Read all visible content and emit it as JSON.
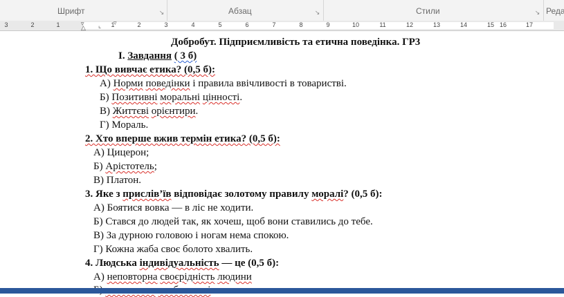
{
  "ribbon": {
    "groups": [
      {
        "label": "Шрифт"
      },
      {
        "label": "Абзац"
      },
      {
        "label": "Стили"
      },
      {
        "label": "Реда"
      }
    ]
  },
  "ruler": {
    "numbers": [
      "3",
      "2",
      "1",
      "1",
      "2",
      "3",
      "4",
      "5",
      "6",
      "7",
      "8",
      "9",
      "10",
      "11",
      "12",
      "13",
      "14",
      "15",
      "16",
      "17"
    ]
  },
  "document": {
    "title": "Добробут. Підприємливість та етична поведінка. ГР3",
    "section": {
      "roman": "I.",
      "label": "Завдання",
      "points": "( 3 б)"
    },
    "q1": {
      "question": "1. Що вивчає етика? (0,5 б):",
      "a": {
        "prefix": "А) ",
        "w1": "Норми",
        "s1": " ",
        "w2": "поведінки",
        "rest": " і правила ввічливості в товаристві."
      },
      "b": {
        "prefix": "Б) ",
        "w1": "Позитивні",
        "s1": " ",
        "w2": "моральні",
        "s2": " ",
        "w3": "цінності",
        "rest": "."
      },
      "c": {
        "prefix": "В) ",
        "w1": "Життєві",
        "s1": " ",
        "w2": "орієнтири",
        "rest": "."
      },
      "d": "Г) Мораль."
    },
    "q2": {
      "question": "2. Хто вперше вжив термін етика? (0,5 б):",
      "a": "А) Цицерон;",
      "b": {
        "prefix": "Б) ",
        "w1": "Арістотель",
        "rest": ";"
      },
      "c": "В) Платон."
    },
    "q3": {
      "question_start": "3. Яке з ",
      "question_w": "прислів’їв",
      "question_mid": " відповідає золотому правилу ",
      "question_w2": "моралі",
      "question_end": "? (0,5 б):",
      "a": "А) Боятися вовка — в ліс не ходити.",
      "b": "Б) Стався до людей так, як хочеш, щоб вони ставились до тебе.",
      "c": "В) За дурною головою і ногам нема спокою.",
      "d": "Г) Кожна жаба своє болото хвалить."
    },
    "q4": {
      "question_start": "4. Людська ",
      "question_w": "індивідуальність",
      "question_end": " — це (0,5 б):",
      "a": {
        "prefix": "А) ",
        "w1": "неповторна",
        "s1": " ",
        "w2": "своєрідність",
        "s2": " ",
        "w3": "людини"
      },
      "b": {
        "prefix": "Б) ",
        "w1": "самоповага",
        "s1": " ",
        "w2": "особистості"
      }
    }
  },
  "colors": {
    "spellcheck_red": "#d9302a",
    "grammar_blue": "#2b5fcf",
    "ribbon_bg": "#f3f3f3",
    "ruler_bg": "#e9e9e9",
    "status_blue": "#2b579a"
  }
}
